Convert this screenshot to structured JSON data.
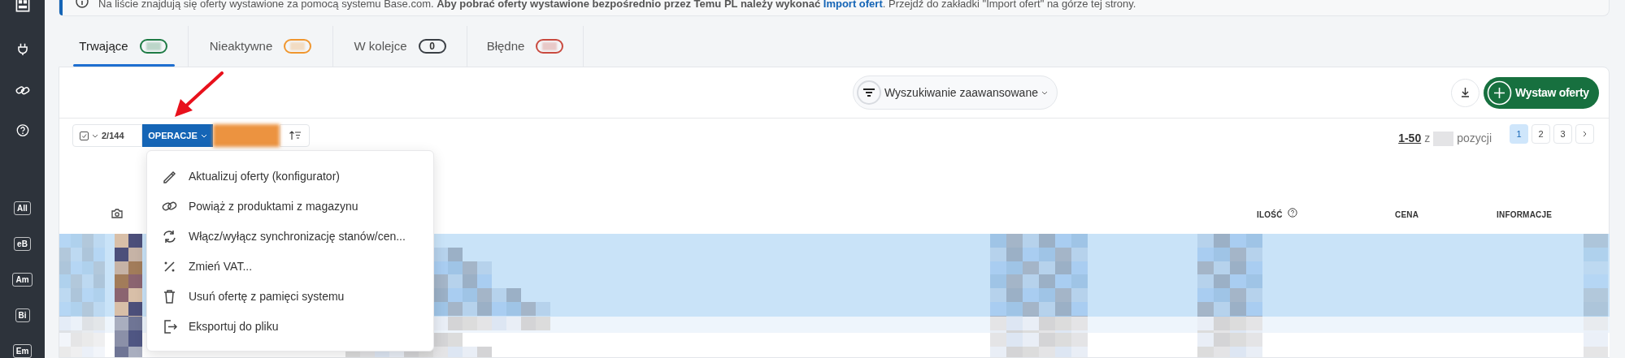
{
  "sidebar": {
    "badges": [
      "All",
      "eB",
      "Am",
      "Bi",
      "Em"
    ]
  },
  "banner": {
    "text": "Na liście znajdują się oferty wystawione za pomocą systemu Base.com. **Aby pobrać oferty wystawione bezpośrednio przez Temu PL należy wykonać**",
    "link": "Import ofert",
    "text_after": ". Przejdź do zakładki \"Import ofert\" na górze tej strony."
  },
  "tabs": [
    {
      "label": "Trwające",
      "selected": true,
      "color": "#1e7b45"
    },
    {
      "label": "Nieaktywne",
      "selected": false,
      "color": "#f0962e"
    },
    {
      "label": "W kolejce",
      "selected": false,
      "color": "#3a3f45",
      "count": "0"
    },
    {
      "label": "Błędne",
      "selected": false,
      "color": "#c94a3f"
    }
  ],
  "advanced_search": "Wyszukiwanie zaawansowane",
  "primary_button": "Wystaw oferty",
  "toolbar": {
    "selection_count": "2/144",
    "operations_button": "OPERACJE"
  },
  "pagination": {
    "range": "1-50",
    "of": "z",
    "suffix": "pozycji",
    "pages": [
      {
        "label": "1",
        "selected": true
      },
      {
        "label": "2",
        "selected": false
      },
      {
        "label": "3",
        "selected": false
      }
    ]
  },
  "menu": {
    "items": [
      {
        "kind": "edit",
        "label": "Aktualizuj oferty (konfigurator)"
      },
      {
        "kind": "link",
        "label": "Powiąż z produktami z magazynu"
      },
      {
        "kind": "sync",
        "label": "Włącz/wyłącz synchronizację stanów/cen..."
      },
      {
        "kind": "percent",
        "label": "Zmień VAT..."
      },
      {
        "kind": "delete",
        "label": "Usuń ofertę z pamięci systemu"
      },
      {
        "kind": "export",
        "label": "Eksportuj do pliku"
      }
    ]
  },
  "table": {
    "columns": [
      "ILOŚĆ",
      "CENA",
      "INFORMACJE"
    ],
    "rows": [
      {
        "selected": true
      },
      {
        "selected": true
      },
      {
        "selected": false
      },
      {
        "selected": false
      }
    ]
  }
}
